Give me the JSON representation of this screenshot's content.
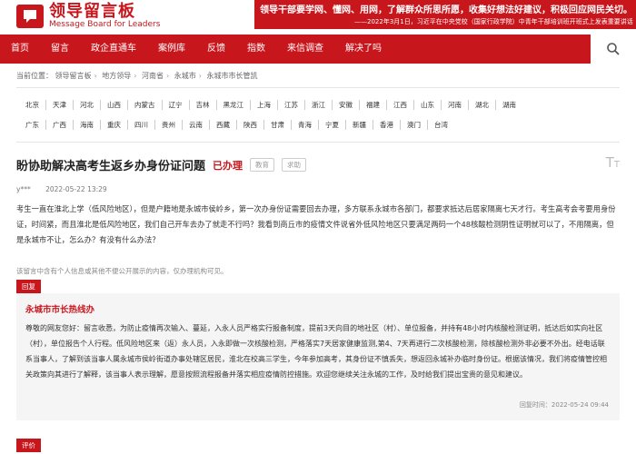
{
  "brand": {
    "name_cn": "领导留言板",
    "name_en": "Message Board for Leaders"
  },
  "banner": {
    "line1": "领导干部要学网、懂网、用网，了解群众所思所愿，收集好想法好建议，积极回应网民关切。",
    "line2": "——2022年3月1日，习近平在中央党校（国家行政学院）中青年干部培训班开班式上发表重要讲话"
  },
  "nav": {
    "items": [
      "首页",
      "留言",
      "政企直通车",
      "案例库",
      "反馈",
      "指数",
      "来信调查",
      "解决了吗"
    ]
  },
  "breadcrumb": {
    "prefix": "当前位置：",
    "items": [
      "领导留言板",
      "地方领导",
      "河南省",
      "永城市",
      "永城市市长管凯"
    ]
  },
  "regions": {
    "row1": [
      "北京",
      "天津",
      "河北",
      "山西",
      "内蒙古",
      "辽宁",
      "吉林",
      "黑龙江",
      "上海",
      "江苏",
      "浙江",
      "安徽",
      "福建",
      "江西",
      "山东",
      "河南",
      "湖北",
      "湖南"
    ],
    "row2": [
      "广东",
      "广西",
      "海南",
      "重庆",
      "四川",
      "贵州",
      "云南",
      "西藏",
      "陕西",
      "甘肃",
      "青海",
      "宁夏",
      "新疆",
      "香港",
      "澳门",
      "台湾"
    ]
  },
  "message": {
    "title": "盼协助解决高考生返乡办身份证问题",
    "status": "已办理",
    "tags": [
      "教育",
      "求助"
    ],
    "author": "y***",
    "time": "2022-05-22 13:29",
    "body": "考生一直在淮北上学（低风险地区），但是户籍地是永城市侯岭乡，第一次办身份证需要回去办理，多方联系永城市各部门，都要求抵达后居家隔离七天才行。考生高考会考要用身份证，时间紧，而且淮北是低风险地区，我们自己开车去办了就走不行吗？我看到商丘市的疫情文件说省外低风险地区只要满足两码一个48核酸检测阴性证明就可以了，不用隔离，但是永城市不让，怎么办？有没有什么办法？",
    "privacy_notice": "该留言中含有个人信息或其他不便公开展示的内容，仅办理机构可见。"
  },
  "reply": {
    "label": "回复",
    "org": "永城市市长热线办",
    "body": "尊敬的网友您好：留言收悉，为防止疫情再次输入、蔓延，入永人员严格实行报备制度，提前3天向目的地社区（村）、单位报备，并持有48小时内核酸检测证明，抵达后如实向社区（村），单位报告个人行程。低风险地区来（返）永人员，入永即做一次核酸检测，严格落实7天居家健康监测,第4、7天再进行二次核酸检测，除核酸检测外非必要不外出。经电话联系当事人，了解到该当事人属永城市侯岭街道办事处辖区居民，淮北在校高三学生，今年参加高考，其身份证不慎丢失，想返回永城补办临时身份证。根据该情况，我们将疫情管控相关政策向其进行了解释，该当事人表示理解，愿意按照流程报备并落实相应疫情防控措施。欢迎您继续关注永城的工作，及时给我们提出宝贵的意见和建议。",
    "time_label": "回复时间：2022-05-24 09:44"
  },
  "evaluation": {
    "label": "评价"
  }
}
